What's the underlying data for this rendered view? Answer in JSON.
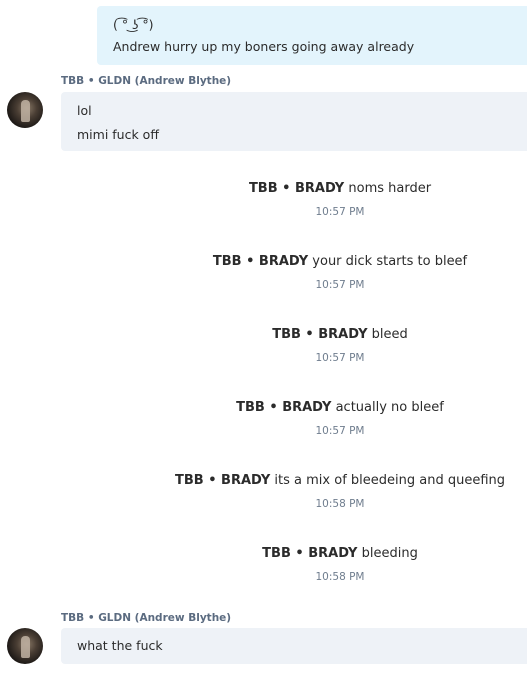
{
  "outgoing_message": {
    "lines": [
      "( ͡° ͜ʖ ͡°)",
      "Andrew hurry up my boners going away already"
    ]
  },
  "messages": [
    {
      "sender": "TBB • GLDN (Andrew Blythe)",
      "lines": [
        "lol",
        "mimi fuck off"
      ]
    },
    {
      "sender": "TBB • GLDN (Andrew Blythe)",
      "lines": [
        "what the fuck"
      ]
    }
  ],
  "notices": [
    {
      "who": "TBB • BRADY",
      "text": "noms harder",
      "time": "10:57 PM"
    },
    {
      "who": "TBB • BRADY",
      "text": "your dick starts to bleef",
      "time": "10:57 PM"
    },
    {
      "who": "TBB • BRADY",
      "text": "bleed",
      "time": "10:57 PM"
    },
    {
      "who": "TBB • BRADY",
      "text": "actually no bleef",
      "time": "10:57 PM"
    },
    {
      "who": "TBB • BRADY",
      "text": "its a mix of bleedeing and queefing",
      "time": "10:58 PM"
    },
    {
      "who": "TBB • BRADY",
      "text": "bleeding",
      "time": "10:58 PM"
    }
  ]
}
